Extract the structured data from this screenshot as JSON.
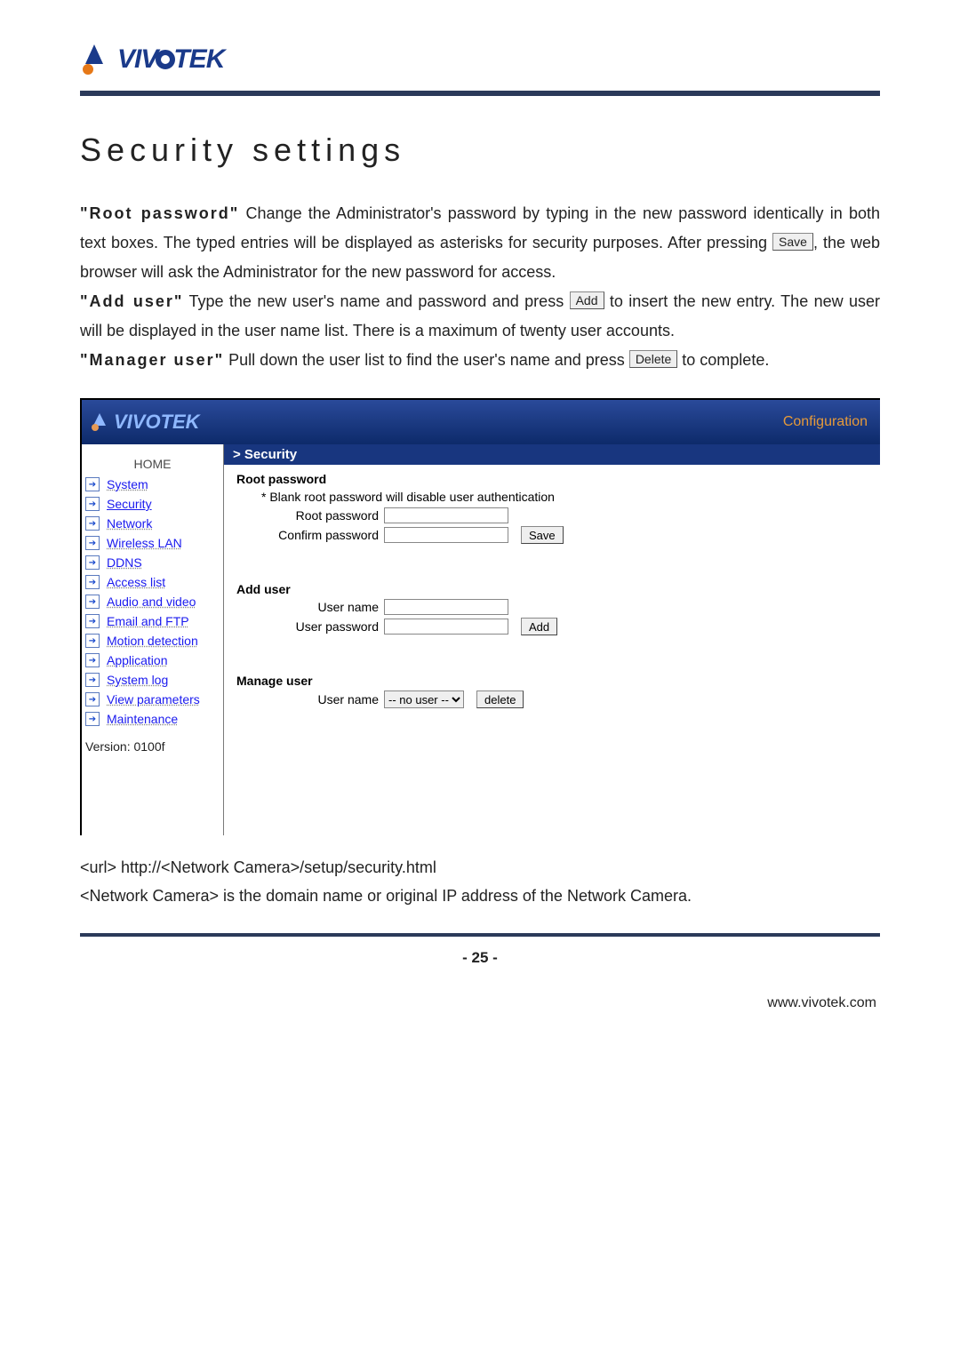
{
  "brand": "VIVOTEK",
  "title": "Security settings",
  "para": {
    "root_label": "\"Root password\"",
    "root_rest1": " Change the Administrator's password by typing in the new password identically in both text boxes. The typed entries will be displayed as asterisks for security purposes. After pressing ",
    "save_btn": "Save",
    "root_rest2": ", the web browser will ask the Administrator for the new password for access.",
    "add_label": "\"Add user\"",
    "add_rest1": " Type the new user's name and password and press ",
    "add_btn": "Add",
    "add_rest2": " to insert the new entry. The new user will be displayed in the user name list. There is a maximum of twenty user accounts.",
    "mgr_label": "\"Manager user\"",
    "mgr_rest1": " Pull down the user list to find the user's name and press ",
    "del_btn": "Delete",
    "mgr_rest2": " to complete."
  },
  "shot": {
    "logo": "VIVOTEK",
    "config": "Configuration",
    "crumb": "> Security",
    "home": "HOME",
    "nav": {
      "system": "System",
      "security": "Security",
      "network": "Network",
      "wlan": "Wireless LAN",
      "ddns": "DDNS",
      "access": "Access list",
      "av": "Audio and video",
      "email": "Email and FTP",
      "motion": "Motion detection",
      "app": "Application",
      "syslog": "System log",
      "viewp": "View parameters",
      "maint": "Maintenance"
    },
    "version": "Version: 0100f",
    "root": {
      "heading": "Root password",
      "note": "* Blank root password will disable user authentication",
      "pw_label": "Root password",
      "cpw_label": "Confirm password",
      "save": "Save"
    },
    "adduser": {
      "heading": "Add user",
      "name_label": "User name",
      "pw_label": "User password",
      "add": "Add"
    },
    "manage": {
      "heading": "Manage user",
      "name_label": "User name",
      "option": "-- no user --",
      "delete": "delete"
    }
  },
  "below": {
    "line1": "<url> http://<Network Camera>/setup/security.html",
    "line2": "<Network Camera> is the domain name or original IP address of the Network Camera."
  },
  "pagenum": "- 25 -",
  "site": "www.vivotek.com"
}
